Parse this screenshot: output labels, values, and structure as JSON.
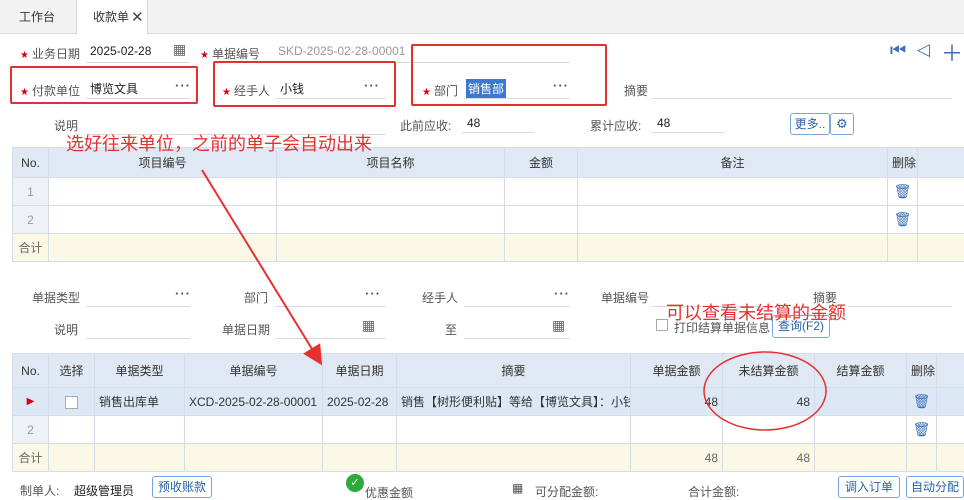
{
  "tabs": {
    "workbench": "工作台",
    "receipt": "收款单"
  },
  "form": {
    "biz_date_label": "业务日期",
    "biz_date": "2025-02-28",
    "bill_no_label": "单据编号",
    "bill_no": "SKD-2025-02-28-00001",
    "payer_label": "付款单位",
    "payer": "博览文具",
    "handler_label": "经手人",
    "handler": "小钱",
    "dept_label": "部门",
    "dept": "销售部",
    "summary_label": "摘要",
    "note_label": "说明",
    "prev_receivable_label": "此前应收:",
    "prev_receivable": "48",
    "total_receivable_label": "累计应收:",
    "total_receivable": "48",
    "more_btn": "更多..",
    "ellipsis": "···"
  },
  "grid1": {
    "headers": [
      "No.",
      "项目编号",
      "项目名称",
      "金额",
      "备注",
      "删除"
    ],
    "row_numbers": [
      "1",
      "2"
    ],
    "total_label": "合计"
  },
  "filter": {
    "bill_type_label": "单据类型",
    "dept_label": "部门",
    "handler_label": "经手人",
    "bill_no_label": "单据编号",
    "summary_label": "摘要",
    "note_label": "说明",
    "bill_date_label": "单据日期",
    "to_label": "至",
    "print_check_label": "打印结算单据信息",
    "query_btn": "查询(F2)"
  },
  "grid2": {
    "headers": [
      "No.",
      "选择",
      "单据类型",
      "单据编号",
      "单据日期",
      "摘要",
      "单据金额",
      "未结算金额",
      "结算金额",
      "删除"
    ],
    "rows": [
      {
        "no": "▶",
        "type": "销售出库单",
        "bill_no": "XCD-2025-02-28-00001",
        "date": "2025-02-28",
        "summary": "销售【树形便利贴】等给【博览文具】：小钱",
        "amount": "48",
        "unsettled": "48"
      },
      {
        "no": "2",
        "type": "",
        "bill_no": "",
        "date": "",
        "summary": "",
        "amount": "",
        "unsettled": ""
      }
    ],
    "total_label": "合计",
    "total_amount": "48",
    "total_unsettled": "48"
  },
  "footer": {
    "maker_label": "制单人:",
    "maker": "超级管理员",
    "prepay_btn": "预收账款",
    "discount_label": "优惠金额",
    "allocatable_label": "可分配金额:",
    "total_label": "合计金额:",
    "import_btn": "调入订单",
    "auto_btn": "自动分配"
  },
  "annotations": {
    "note1": "选好往来单位，之前的单子会自动出来",
    "note2": "可以查看未结算的金额"
  },
  "colors": {
    "annotation": "#e53030",
    "header_bg": "#dfe8f3",
    "accent": "#2a62a8"
  }
}
